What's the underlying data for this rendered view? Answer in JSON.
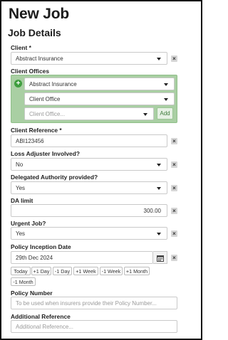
{
  "page": {
    "title": "New Job",
    "section": "Job Details"
  },
  "client": {
    "label": "Client *",
    "value": "Abstract Insurance"
  },
  "client_offices": {
    "label": "Client Offices",
    "insurer": "Abstract Insurance",
    "office": "Client Office",
    "new_placeholder": "Client Office...",
    "add_label": "Add"
  },
  "client_reference": {
    "label": "Client Reference *",
    "value": "ABI123456"
  },
  "loss_adjuster": {
    "label": "Loss Adjuster Involved?",
    "value": "No"
  },
  "delegated_authority": {
    "label": "Delegated Authority provided?",
    "value": "Yes"
  },
  "da_limit": {
    "label": "DA limit",
    "value": "300.00"
  },
  "urgent": {
    "label": "Urgent Job?",
    "value": "Yes"
  },
  "policy_inception": {
    "label": "Policy Inception Date",
    "value": "29th Dec 2024",
    "quick": [
      "Today",
      "+1 Day",
      "-1 Day",
      "+1 Week",
      "-1 Week",
      "+1 Month",
      "-1 Month"
    ]
  },
  "policy_number": {
    "label": "Policy Number",
    "placeholder": "To be used when insurers provide their Policy Number..."
  },
  "additional_reference": {
    "label": "Additional Reference",
    "placeholder": "Additional Reference..."
  },
  "clear_symbol": "×"
}
